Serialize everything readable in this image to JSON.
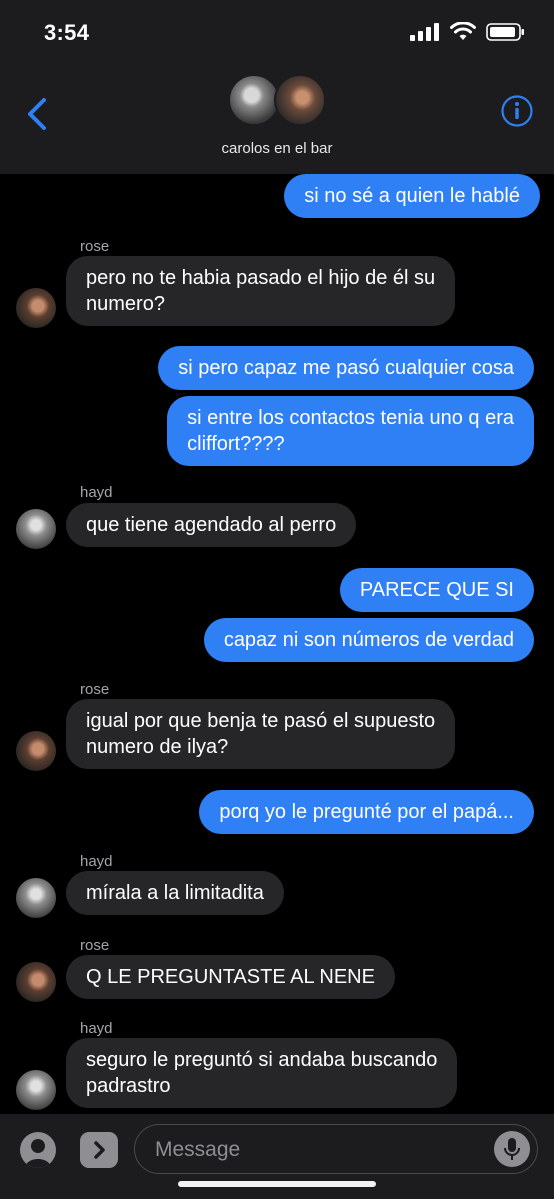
{
  "status": {
    "time": "3:54",
    "icons": [
      "signal-icon",
      "wifi-icon",
      "battery-icon"
    ]
  },
  "header": {
    "back_icon": "chevron-left-icon",
    "group_name": "carolos en el bar",
    "info_icon": "info-icon",
    "accent": "#2f7ff5"
  },
  "messages": [
    {
      "kind": "sent",
      "text": "si no sé a quien le hablé"
    },
    {
      "kind": "sender",
      "text": "rose"
    },
    {
      "kind": "recv",
      "lines": [
        "pero no te habia pasado el hijo de él su",
        "numero?"
      ]
    },
    {
      "kind": "sent",
      "text": "si pero capaz me pasó cualquier cosa"
    },
    {
      "kind": "sent",
      "lines": [
        "si entre los contactos tenia uno q era",
        "cliffort????"
      ]
    },
    {
      "kind": "sender",
      "text": "hayd"
    },
    {
      "kind": "recv",
      "text": "que tiene agendado al perro"
    },
    {
      "kind": "sent",
      "text": "PARECE QUE SI"
    },
    {
      "kind": "sent",
      "text": "capaz ni son números de verdad"
    },
    {
      "kind": "sender",
      "text": "rose"
    },
    {
      "kind": "recv",
      "lines": [
        "igual por que benja te pasó el supuesto",
        "numero de ilya?"
      ]
    },
    {
      "kind": "sent",
      "text": "porq yo le pregunté por el papá..."
    },
    {
      "kind": "sender",
      "text": "hayd"
    },
    {
      "kind": "recv",
      "text": "mírala a la limitadita"
    },
    {
      "kind": "sender",
      "text": "rose"
    },
    {
      "kind": "recv",
      "text": "Q LE PREGUNTASTE AL NENE"
    },
    {
      "kind": "sender",
      "text": "hayd"
    },
    {
      "kind": "recv",
      "lines": [
        "seguro le preguntó si andaba buscando",
        "padrastro"
      ]
    }
  ],
  "input": {
    "placeholder": "Message",
    "person_icon": "person-icon",
    "apps_icon": "chevron-right-icon",
    "mic_icon": "microphone-icon"
  },
  "colors": {
    "sent_bubble": "#2f7ff5",
    "received_bubble": "#262628",
    "background": "#000000",
    "bar": "#1c1c1e"
  }
}
